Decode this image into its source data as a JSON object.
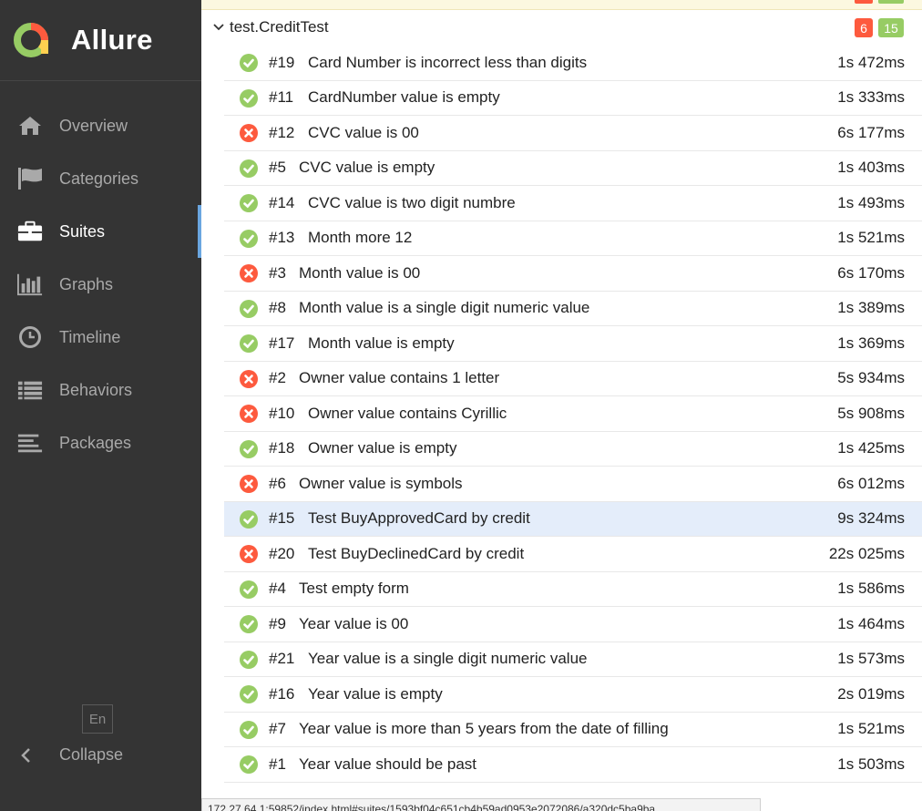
{
  "brand": {
    "name": "Allure"
  },
  "nav": [
    {
      "label": "Overview",
      "icon": "home-icon"
    },
    {
      "label": "Categories",
      "icon": "flag-icon"
    },
    {
      "label": "Suites",
      "icon": "briefcase-icon",
      "active": true
    },
    {
      "label": "Graphs",
      "icon": "bar-chart-icon"
    },
    {
      "label": "Timeline",
      "icon": "clock-icon"
    },
    {
      "label": "Behaviors",
      "icon": "list-icon"
    },
    {
      "label": "Packages",
      "icon": "align-left-icon"
    }
  ],
  "language_button": "En",
  "collapse_label": "Collapse",
  "group": {
    "name": "test.CreditTest",
    "failed_count": "6",
    "passed_count": "15"
  },
  "colors": {
    "passed": "#97cc64",
    "failed": "#fd5a3e",
    "active_accent": "#6aa6e0",
    "selected_row": "#e4edfa"
  },
  "tests": [
    {
      "num": "#19",
      "name": "Card Number is incorrect less than digits",
      "duration": "1s 472ms",
      "status": "passed"
    },
    {
      "num": "#11",
      "name": "CardNumber value is empty",
      "duration": "1s 333ms",
      "status": "passed"
    },
    {
      "num": "#12",
      "name": "CVC value is 00",
      "duration": "6s 177ms",
      "status": "failed"
    },
    {
      "num": "#5",
      "name": "CVC value is empty",
      "duration": "1s 403ms",
      "status": "passed"
    },
    {
      "num": "#14",
      "name": "CVC value is two digit numbre",
      "duration": "1s 493ms",
      "status": "passed"
    },
    {
      "num": "#13",
      "name": "Month more 12",
      "duration": "1s 521ms",
      "status": "passed"
    },
    {
      "num": "#3",
      "name": "Month value is 00",
      "duration": "6s 170ms",
      "status": "failed"
    },
    {
      "num": "#8",
      "name": "Month value is a single digit numeric value",
      "duration": "1s 389ms",
      "status": "passed"
    },
    {
      "num": "#17",
      "name": "Month value is empty",
      "duration": "1s 369ms",
      "status": "passed"
    },
    {
      "num": "#2",
      "name": "Owner value contains 1 letter",
      "duration": "5s 934ms",
      "status": "failed"
    },
    {
      "num": "#10",
      "name": "Owner value contains Cyrillic",
      "duration": "5s 908ms",
      "status": "failed"
    },
    {
      "num": "#18",
      "name": "Owner value is empty",
      "duration": "1s 425ms",
      "status": "passed"
    },
    {
      "num": "#6",
      "name": "Owner value is symbols",
      "duration": "6s 012ms",
      "status": "failed"
    },
    {
      "num": "#15",
      "name": "Test BuyApprovedCard by credit",
      "duration": "9s 324ms",
      "status": "passed",
      "selected": true
    },
    {
      "num": "#20",
      "name": "Test BuyDeclinedCard by credit",
      "duration": "22s 025ms",
      "status": "failed"
    },
    {
      "num": "#4",
      "name": "Test empty form",
      "duration": "1s 586ms",
      "status": "passed"
    },
    {
      "num": "#9",
      "name": "Year value is 00",
      "duration": "1s 464ms",
      "status": "passed"
    },
    {
      "num": "#21",
      "name": "Year value is a single digit numeric value",
      "duration": "1s 573ms",
      "status": "passed"
    },
    {
      "num": "#16",
      "name": "Year value is empty",
      "duration": "2s 019ms",
      "status": "passed"
    },
    {
      "num": "#7",
      "name": "Year value is more than 5 years from the date of filling",
      "duration": "1s 521ms",
      "status": "passed"
    },
    {
      "num": "#1",
      "name": "Year value should be past",
      "duration": "1s 503ms",
      "status": "passed"
    }
  ],
  "status_bar_url": "172.27.64.1:59852/index.html#suites/1593bf04c651cb4b59ad0953e2072086/a320dc5ba9ba"
}
